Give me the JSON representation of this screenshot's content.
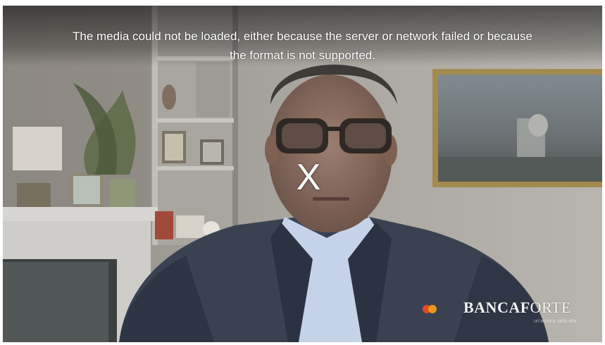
{
  "video": {
    "error_lines": [
      "The media could not be loaded, either because the server or network failed or because",
      "the format is not supported."
    ],
    "close_glyph": "X",
    "brand": {
      "name": "BANCAFORTE",
      "name_bold_part": "BANCAF",
      "name_light_part": "ORTE",
      "tagline": "un'ancora nella vita",
      "logo_icon": "mastercard-circles-icon",
      "accent_colors": [
        "#e8471f",
        "#f6a21a"
      ]
    }
  }
}
